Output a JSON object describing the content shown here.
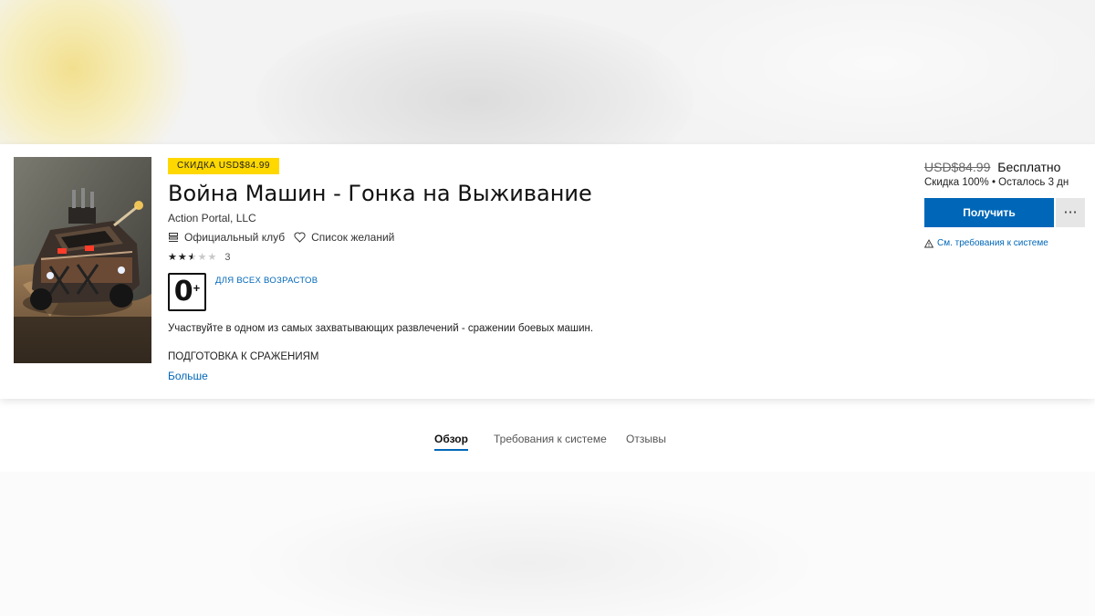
{
  "product": {
    "discount_badge": "СКИДКА USD$84.99",
    "title": "Война Машин - Гонка на Выживание",
    "publisher": "Action Portal, LLC",
    "official_club": "Официальный клуб",
    "wishlist": "Список желаний",
    "rating": {
      "stars": 2.5,
      "max": 5,
      "count": "3"
    },
    "age": {
      "number": "0",
      "plus": "+",
      "label": "ДЛЯ ВСЕХ ВОЗРАСТОВ"
    },
    "description": "Участвуйте в одном из самых захватывающих развлечений - сражении боевых машин.",
    "section_heading": "ПОДГОТОВКА К СРАЖЕНИЯМ",
    "more_link": "Больше"
  },
  "purchase": {
    "old_price": "USD$84.99",
    "new_price": "Бесплатно",
    "discount_info": "Скидка 100% • Осталось 3 дн",
    "get_button": "Получить",
    "more_button": "···",
    "sysreq_link": "См. требования к системе"
  },
  "tabs": [
    {
      "label": "Обзор",
      "active": true
    },
    {
      "label": "Требования к системе",
      "active": false
    },
    {
      "label": "Отзывы",
      "active": false
    }
  ],
  "colors": {
    "accent": "#0067b8",
    "badge": "#ffd800"
  },
  "icons": {
    "club": "club-icon",
    "wishlist": "heart-icon",
    "warning": "warning-icon",
    "star": "star-icon"
  }
}
